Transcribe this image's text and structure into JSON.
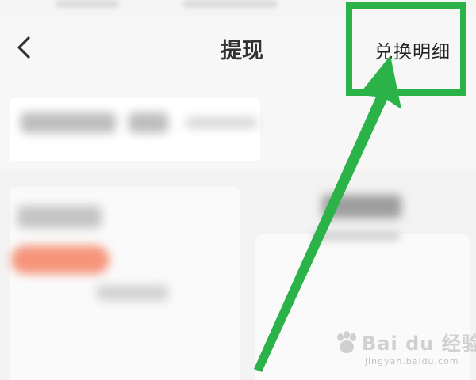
{
  "header": {
    "back_icon": "chevron-left-icon",
    "title": "提现",
    "details_link": "兑换明细"
  },
  "annotation": {
    "highlight_color": "#2bb34a"
  },
  "watermark": {
    "brand": "Bai du 经验",
    "url": "jingyan.baidu.com"
  },
  "colors": {
    "background": "#f7f7f7",
    "promo": "#f58a6e"
  }
}
